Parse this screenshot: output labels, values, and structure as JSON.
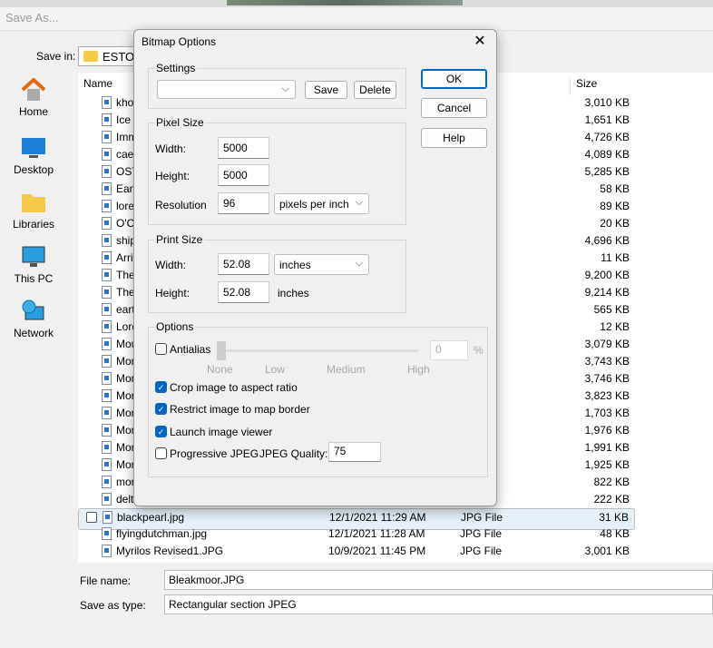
{
  "window": {
    "title": "Save As..."
  },
  "save_in": {
    "label": "Save in:",
    "value": "ESTONI"
  },
  "nav": [
    {
      "label": "Home",
      "icon": "home-icon"
    },
    {
      "label": "Desktop",
      "icon": "desktop-icon"
    },
    {
      "label": "Libraries",
      "icon": "folder-icon"
    },
    {
      "label": "This PC",
      "icon": "pc-icon"
    },
    {
      "label": "Network",
      "icon": "network-icon"
    }
  ],
  "columns": {
    "name": "Name",
    "size": "Size"
  },
  "files": [
    {
      "name": "khor",
      "size": "3,010 KB"
    },
    {
      "name": "Ice F",
      "size": "1,651 KB"
    },
    {
      "name": "Imm",
      "size": "4,726 KB"
    },
    {
      "name": "caer",
      "size": "4,089 KB"
    },
    {
      "name": "OSTI",
      "size": "5,285 KB"
    },
    {
      "name": "Earw",
      "size": "58 KB"
    },
    {
      "name": "lorer",
      "size": "89 KB"
    },
    {
      "name": "O'Ch",
      "size": "20 KB"
    },
    {
      "name": "ships",
      "size": "4,696 KB"
    },
    {
      "name": "Arric",
      "size": "11 KB"
    },
    {
      "name": "The",
      "size": "9,200 KB"
    },
    {
      "name": "The",
      "size": "9,214 KB"
    },
    {
      "name": "earth",
      "size": "565 KB"
    },
    {
      "name": "Lore",
      "size": "12 KB"
    },
    {
      "name": "Mou",
      "size": "3,079 KB"
    },
    {
      "name": "Mor",
      "size": "3,743 KB"
    },
    {
      "name": "Mor",
      "size": "3,746 KB"
    },
    {
      "name": "Mor",
      "size": "3,823 KB"
    },
    {
      "name": "Mor",
      "size": "1,703 KB"
    },
    {
      "name": "Mor",
      "size": "1,976 KB"
    },
    {
      "name": "Mor",
      "size": "1,991 KB"
    },
    {
      "name": "Mor",
      "size": "1,925 KB"
    },
    {
      "name": "mors",
      "size": "822 KB"
    },
    {
      "name": "delta",
      "size": "222 KB"
    },
    {
      "name": "blackpearl.jpg",
      "date": "12/1/2021 11:29 AM",
      "type": "JPG File",
      "size": "31 KB",
      "selected": true
    },
    {
      "name": "flyingdutchman.jpg",
      "date": "12/1/2021 11:28 AM",
      "type": "JPG File",
      "size": "48 KB"
    },
    {
      "name": "Myrilos Revised1.JPG",
      "date": "10/9/2021 11:45 PM",
      "type": "JPG File",
      "size": "3,001 KB"
    }
  ],
  "file_name": {
    "label": "File name:",
    "value": "Bleakmoor.JPG"
  },
  "save_as_type": {
    "label": "Save as type:",
    "value": "Rectangular section JPEG"
  },
  "dialog": {
    "title": "Bitmap Options",
    "close": "✕",
    "settings": {
      "label": "Settings",
      "value": "",
      "save": "Save",
      "delete": "Delete"
    },
    "ok": "OK",
    "cancel": "Cancel",
    "help": "Help",
    "pixel_size": {
      "label": "Pixel Size",
      "width_label": "Width:",
      "width": "5000",
      "height_label": "Height:",
      "height": "5000",
      "resolution_label": "Resolution",
      "resolution": "96",
      "unit": "pixels per inch"
    },
    "print_size": {
      "label": "Print Size",
      "width_label": "Width:",
      "width": "52.08",
      "width_unit": "inches",
      "height_label": "Height:",
      "height": "52.08",
      "height_unit": "inches"
    },
    "options": {
      "label": "Options",
      "antialias": "Antialias",
      "antialias_checked": false,
      "antialias_value": "0",
      "percent": "%",
      "ticks": [
        "None",
        "Low",
        "Medium",
        "High"
      ],
      "crop": "Crop image to aspect ratio",
      "crop_checked": true,
      "restrict": "Restrict image to map border",
      "restrict_checked": true,
      "launch": "Launch image viewer",
      "launch_checked": true,
      "progressive": "Progressive JPEG",
      "progressive_checked": false,
      "quality_label": "JPEG Quality:",
      "quality": "75"
    }
  },
  "colors": {
    "accent": "#0067c0",
    "selection": "#e5f0fb"
  }
}
